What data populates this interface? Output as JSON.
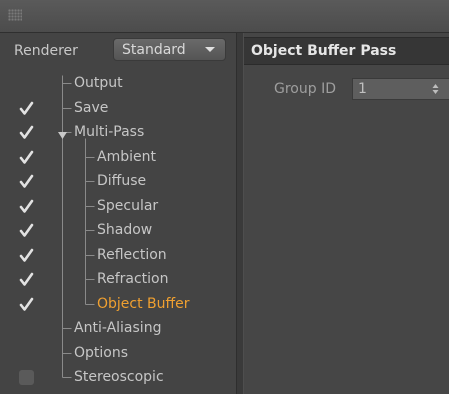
{
  "renderer": {
    "label": "Renderer",
    "value": "Standard"
  },
  "tree": [
    {
      "label": "Output",
      "checkbox": "none"
    },
    {
      "label": "Save",
      "checkbox": "checked"
    },
    {
      "label": "Multi-Pass",
      "checkbox": "checked",
      "expanded": true
    },
    {
      "label": "Ambient",
      "checkbox": "checked"
    },
    {
      "label": "Diffuse",
      "checkbox": "checked"
    },
    {
      "label": "Specular",
      "checkbox": "checked"
    },
    {
      "label": "Shadow",
      "checkbox": "checked"
    },
    {
      "label": "Reflection",
      "checkbox": "checked"
    },
    {
      "label": "Refraction",
      "checkbox": "checked"
    },
    {
      "label": "Object Buffer",
      "checkbox": "checked",
      "selected": true
    },
    {
      "label": "Anti-Aliasing",
      "checkbox": "none"
    },
    {
      "label": "Options",
      "checkbox": "none"
    },
    {
      "label": "Stereoscopic",
      "checkbox": "unchecked"
    }
  ],
  "panel": {
    "title": "Object Buffer Pass",
    "group_id_label": "Group ID",
    "group_id_value": "1"
  },
  "colors": {
    "selected": "#f0a030",
    "text": "#c6c6c6",
    "background": "#444444"
  }
}
